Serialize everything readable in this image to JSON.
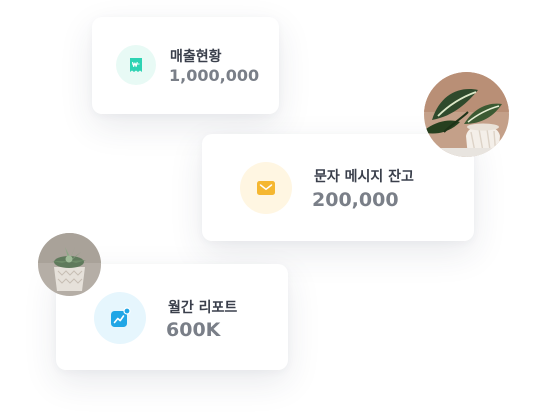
{
  "cards": [
    {
      "label": "매출현황",
      "value": "1,000,000",
      "icon": "won-receipt-icon",
      "icon_color": "#2ed3b3",
      "icon_bg": "#e8faf5"
    },
    {
      "label": "문자 메시지 잔고",
      "value": "200,000",
      "icon": "envelope-icon",
      "icon_color": "#f5b731",
      "icon_bg": "#fff6e2"
    },
    {
      "label": "월간 리포트",
      "value": "600K",
      "icon": "chart-trend-icon",
      "icon_color": "#20a6e6",
      "icon_bg": "#e6f6fd"
    }
  ],
  "photos": [
    {
      "name": "plant-leaf-photo"
    },
    {
      "name": "succulent-photo"
    }
  ]
}
